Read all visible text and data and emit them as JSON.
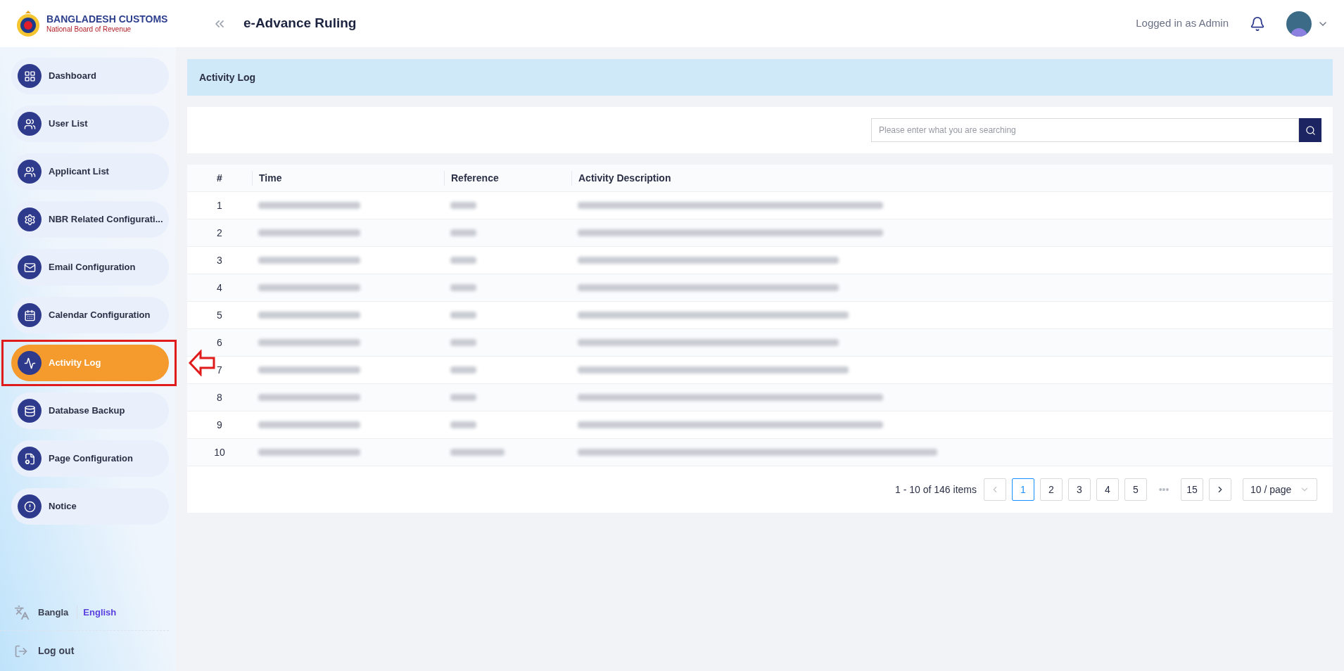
{
  "brand": {
    "title": "BANGLADESH CUSTOMS",
    "subtitle": "National Board of Revenue"
  },
  "header": {
    "app_title": "e-Advance Ruling",
    "user_label": "Logged in as Admin"
  },
  "sidebar": {
    "items": [
      {
        "label": "Dashboard",
        "kind": "dashboard",
        "selected": false,
        "annotated": false
      },
      {
        "label": "User List",
        "kind": "users",
        "selected": false,
        "annotated": false
      },
      {
        "label": "Applicant List",
        "kind": "users",
        "selected": false,
        "annotated": false
      },
      {
        "label": "NBR Related Configurati...",
        "kind": "gear",
        "selected": false,
        "annotated": false
      },
      {
        "label": "Email Configuration",
        "kind": "mail",
        "selected": false,
        "annotated": false
      },
      {
        "label": "Calendar Configuration",
        "kind": "calendar",
        "selected": false,
        "annotated": false
      },
      {
        "label": "Activity Log",
        "kind": "activity",
        "selected": true,
        "annotated": true
      },
      {
        "label": "Database Backup",
        "kind": "database",
        "selected": false,
        "annotated": false
      },
      {
        "label": "Page Configuration",
        "kind": "file",
        "selected": false,
        "annotated": false
      },
      {
        "label": "Notice",
        "kind": "alert",
        "selected": false,
        "annotated": false
      }
    ],
    "languages": [
      {
        "label": "Bangla",
        "selected": false
      },
      {
        "label": "English",
        "selected": true
      }
    ],
    "logout": "Log out"
  },
  "page_title": "Activity Log",
  "search": {
    "placeholder": "Please enter what you are searching"
  },
  "table": {
    "columns": [
      "#",
      "Time",
      "Reference",
      "Activity Description"
    ],
    "rows": [
      {
        "index": "1"
      },
      {
        "index": "2"
      },
      {
        "index": "3"
      },
      {
        "index": "4"
      },
      {
        "index": "5"
      },
      {
        "index": "6"
      },
      {
        "index": "7"
      },
      {
        "index": "8"
      },
      {
        "index": "9"
      },
      {
        "index": "10"
      }
    ]
  },
  "pagination": {
    "summary": "1 - 10 of 146 items",
    "pages": [
      {
        "label": "1",
        "selected": true
      },
      {
        "label": "2",
        "selected": false
      },
      {
        "label": "3",
        "selected": false
      },
      {
        "label": "4",
        "selected": false
      },
      {
        "label": "5",
        "selected": false
      },
      {
        "label": "•••",
        "selected": false
      },
      {
        "label": "15",
        "selected": false
      }
    ],
    "page_size": "10 / page"
  }
}
